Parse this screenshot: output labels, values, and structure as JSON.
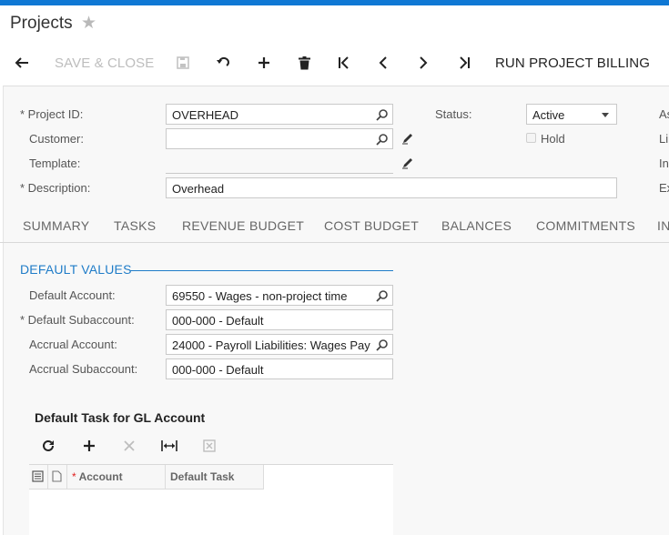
{
  "header": {
    "title": "Projects"
  },
  "toolbar": {
    "save_close_label": "SAVE & CLOSE",
    "run_billing_label": "RUN PROJECT BILLING"
  },
  "summary": {
    "project_id": {
      "label": "Project ID:",
      "value": "OVERHEAD"
    },
    "customer": {
      "label": "Customer:",
      "value": ""
    },
    "template": {
      "label": "Template:",
      "value": ""
    },
    "description": {
      "label": "Description:",
      "value": "Overhead"
    },
    "status": {
      "label": "Status:",
      "value": "Active"
    },
    "hold": {
      "label": "Hold",
      "checked": false
    },
    "right_edge_labels": [
      "As",
      "Li",
      "In",
      "Ex"
    ]
  },
  "tabs": [
    "SUMMARY",
    "TASKS",
    "REVENUE BUDGET",
    "COST BUDGET",
    "BALANCES",
    "COMMITMENTS",
    "IN"
  ],
  "default_values": {
    "title": "DEFAULT VALUES",
    "default_account": {
      "label": "Default Account:",
      "value": "69550 - Wages - non-project time"
    },
    "default_subaccount": {
      "label": "Default Subaccount:",
      "value": "000-000 - Default"
    },
    "accrual_account": {
      "label": "Accrual Account:",
      "value": "24000 - Payroll Liabilities: Wages Pay"
    },
    "accrual_subaccount": {
      "label": "Accrual Subaccount:",
      "value": "000-000 - Default"
    }
  },
  "default_task_grid": {
    "title": "Default Task for GL Account",
    "columns": [
      "Account",
      "Default Task"
    ],
    "rows": []
  },
  "colors": {
    "accent": "#0f78d4",
    "section": "#1f7cc8",
    "required_grid": "#e02020"
  }
}
